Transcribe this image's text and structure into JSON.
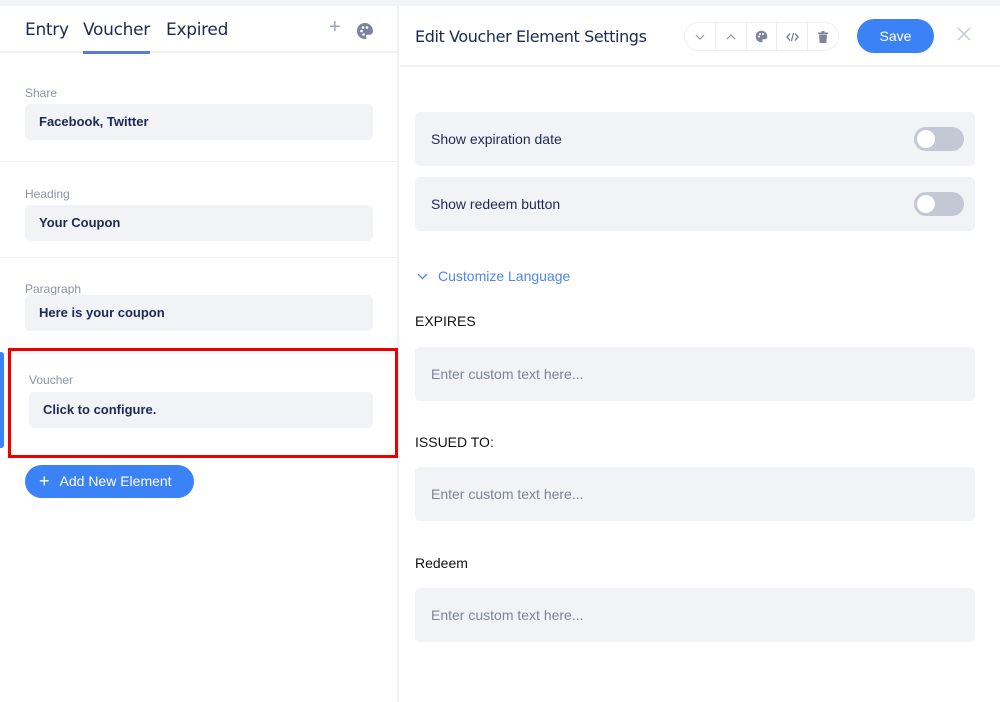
{
  "tabs": [
    {
      "label": "Entry",
      "active": false
    },
    {
      "label": "Voucher",
      "active": true
    },
    {
      "label": "Expired",
      "active": false
    }
  ],
  "tab_actions": {
    "add_icon": "plus-icon",
    "style_icon": "palette-icon"
  },
  "elements": [
    {
      "label": "Share",
      "value": "Facebook, Twitter"
    },
    {
      "label": "Heading",
      "value": "Your Coupon"
    },
    {
      "label": "Paragraph",
      "value": "Here is your coupon"
    },
    {
      "label": "Voucher",
      "value": "Click to configure.",
      "selected": true
    }
  ],
  "add_element_label": "Add New Element",
  "editor": {
    "title": "Edit Voucher Element Settings",
    "toolbar_icons": [
      "chevron-down-icon",
      "chevron-up-icon",
      "palette-icon",
      "code-icon",
      "trash-icon"
    ],
    "save_label": "Save",
    "close_icon": "close-icon",
    "toggles": [
      {
        "label": "Show expiration date",
        "on": false
      },
      {
        "label": "Show redeem button",
        "on": false
      }
    ],
    "customize_language_label": "Customize Language",
    "fields": [
      {
        "label": "EXPIRES",
        "value": "",
        "placeholder": "Enter custom text here..."
      },
      {
        "label": "ISSUED TO:",
        "value": "",
        "placeholder": "Enter custom text here..."
      },
      {
        "label": "Redeem",
        "value": "",
        "placeholder": "Enter custom text here..."
      }
    ]
  },
  "colors": {
    "accent": "#3b82f6",
    "tab_underline": "#5a77e3",
    "highlight_box": "#ee0000",
    "text_dark": "#1b2a55"
  }
}
